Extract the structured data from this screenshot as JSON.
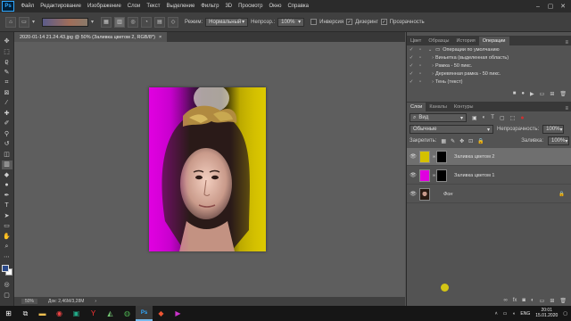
{
  "app": {
    "logo": "Ps"
  },
  "menu": [
    "Файл",
    "Редактирование",
    "Изображение",
    "Слои",
    "Текст",
    "Выделение",
    "Фильтр",
    "3D",
    "Просмотр",
    "Окно",
    "Справка"
  ],
  "window_controls": [
    "–",
    "▢",
    "✕"
  ],
  "options_bar": {
    "mode_label": "Режим:",
    "mode_value": "Нормальный",
    "opacity_label": "Непрозр.:",
    "opacity_value": "100%",
    "invert_label": "Инверсия",
    "dither_label": "Дизеринг",
    "dither_checked": true,
    "transparency_label": "Прозрачность",
    "transparency_checked": true
  },
  "document": {
    "tab_title": "2020-01-14 21.24.43.jpg @ 50% (Заливка цветом 2, RGB/8*)",
    "tab_close": "×",
    "zoom": "50%",
    "doc_size": "Док: 2,46M/3,28M"
  },
  "operations_panel": {
    "tabs": [
      "Цвет",
      "Образцы",
      "История",
      "Операции"
    ],
    "active_tab": "Операции",
    "items": [
      {
        "expanded": true,
        "is_folder": true,
        "label": "Операции по умолчанию"
      },
      {
        "expanded": false,
        "is_folder": false,
        "label": "Виньетка (выделенная область)"
      },
      {
        "expanded": false,
        "is_folder": false,
        "label": "Рамка - 50 пикс."
      },
      {
        "expanded": false,
        "is_folder": false,
        "label": "Деревянная рамка - 50 пикс."
      },
      {
        "expanded": false,
        "is_folder": false,
        "label": "Тень (текст)"
      }
    ]
  },
  "layers_panel": {
    "tabs": [
      "Слои",
      "Каналы",
      "Контуры"
    ],
    "active_tab": "Слои",
    "filter_label": "Вид",
    "blend_mode": "Обычные",
    "opacity_label": "Непрозрачность:",
    "opacity_value": "100%",
    "lock_label": "Закрепить:",
    "fill_label": "Заливка:",
    "fill_value": "100%",
    "layers": [
      {
        "name": "Заливка цветом 2",
        "color": "#d4c100",
        "selected": true,
        "has_mask": true,
        "visible": true
      },
      {
        "name": "Заливка цветом 1",
        "color": "#e000e0",
        "selected": false,
        "has_mask": true,
        "visible": true
      },
      {
        "name": "Фон",
        "color": "#2a1c14",
        "selected": false,
        "has_mask": false,
        "visible": true
      }
    ],
    "footer_icons": [
      "link-icon",
      "fx-icon",
      "mask-icon",
      "adjustment-icon",
      "group-icon",
      "new-layer-icon",
      "trash-icon"
    ]
  },
  "colors": {
    "magenta": "#e000e0",
    "yellow": "#d4c100",
    "foreground": "#2b4a8a",
    "background": "#ffffff"
  },
  "taskbar": {
    "language": "ENG",
    "time": "20:01",
    "date": "15.01.2020"
  }
}
